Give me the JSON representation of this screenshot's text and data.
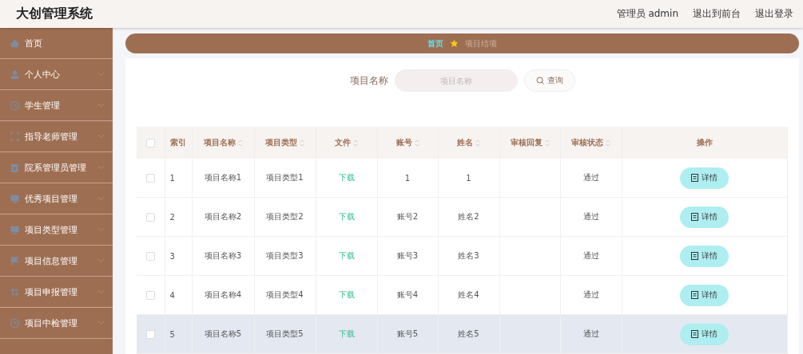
{
  "header": {
    "title": "大创管理系统",
    "links": [
      "管理员 admin",
      "退出到前台",
      "退出登录"
    ]
  },
  "sidebar": {
    "items": [
      {
        "label": "首页",
        "kind": "link"
      },
      {
        "label": "个人中心",
        "kind": "submenu"
      },
      {
        "label": "学生管理",
        "kind": "submenu"
      },
      {
        "label": "指导老师管理",
        "kind": "submenu"
      },
      {
        "label": "院系管理员管理",
        "kind": "submenu"
      },
      {
        "label": "优秀项目管理",
        "kind": "submenu"
      },
      {
        "label": "项目类型管理",
        "kind": "submenu"
      },
      {
        "label": "项目信息管理",
        "kind": "submenu"
      },
      {
        "label": "项目申报管理",
        "kind": "submenu"
      },
      {
        "label": "项目中检管理",
        "kind": "submenu"
      }
    ]
  },
  "breadcrumb": [
    "首页",
    "项目结项"
  ],
  "search": {
    "label": "项目名称",
    "placeholder": "项目名称",
    "button": "查询"
  },
  "table": {
    "columns": [
      {
        "label": "索引",
        "sortable": false
      },
      {
        "label": "项目名称",
        "sortable": true
      },
      {
        "label": "项目类型",
        "sortable": true
      },
      {
        "label": "文件",
        "sortable": true
      },
      {
        "label": "账号",
        "sortable": true
      },
      {
        "label": "姓名",
        "sortable": true
      },
      {
        "label": "审核回复",
        "sortable": true
      },
      {
        "label": "审核状态",
        "sortable": true
      },
      {
        "label": "操作",
        "sortable": false
      }
    ],
    "header_checked": false,
    "rows": [
      {
        "checked": false,
        "highlighted": false,
        "cells": [
          "1",
          "项目名称1",
          "项目类型1",
          "下载",
          "1",
          "1",
          "",
          "通过"
        ],
        "action": "详情"
      },
      {
        "checked": false,
        "highlighted": false,
        "cells": [
          "2",
          "项目名称2",
          "项目类型2",
          "下载",
          "账号2",
          "姓名2",
          "",
          "通过"
        ],
        "action": "详情"
      },
      {
        "checked": false,
        "highlighted": false,
        "cells": [
          "3",
          "项目名称3",
          "项目类型3",
          "下载",
          "账号3",
          "姓名3",
          "",
          "通过"
        ],
        "action": "详情"
      },
      {
        "checked": false,
        "highlighted": false,
        "cells": [
          "4",
          "项目名称4",
          "项目类型4",
          "下载",
          "账号4",
          "姓名4",
          "",
          "通过"
        ],
        "action": "详情"
      },
      {
        "checked": false,
        "highlighted": true,
        "cells": [
          "5",
          "项目名称5",
          "项目类型5",
          "下载",
          "账号5",
          "姓名5",
          "",
          "通过"
        ],
        "action": "详情"
      }
    ]
  }
}
